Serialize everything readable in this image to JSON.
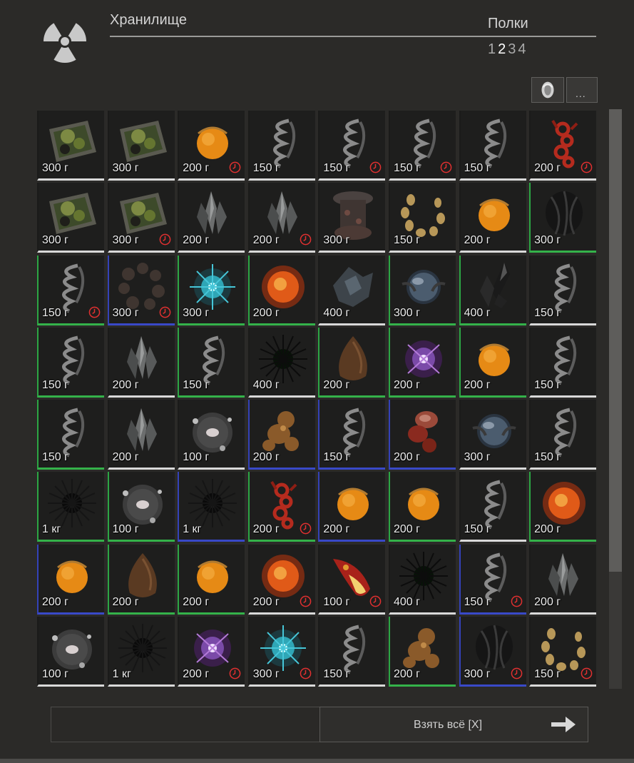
{
  "header": {
    "title": "Хранилище",
    "shelves_label": "Полки",
    "pages": [
      "1",
      "2",
      "3",
      "4"
    ],
    "active_page": "2",
    "logo_icon": "radiation-icon"
  },
  "toolbar": {
    "filter_icon": "artifact-filter-icon",
    "more_label": "..."
  },
  "colors": {
    "rarity_common": "#d9d9d9",
    "rarity_green": "#34b24a",
    "rarity_blue": "#3949c8",
    "timer_icon": "#e03030"
  },
  "grid": {
    "cells": [
      {
        "item": "moss",
        "weight": "300 г",
        "rarity": "common",
        "timer": false
      },
      {
        "item": "moss",
        "weight": "300 г",
        "rarity": "common",
        "timer": false
      },
      {
        "item": "orange-orb",
        "weight": "200 г",
        "rarity": "common",
        "timer": true
      },
      {
        "item": "shell",
        "weight": "150 г",
        "rarity": "common",
        "timer": false
      },
      {
        "item": "shell",
        "weight": "150 г",
        "rarity": "common",
        "timer": true
      },
      {
        "item": "shell",
        "weight": "150 г",
        "rarity": "common",
        "timer": true
      },
      {
        "item": "shell",
        "weight": "150 г",
        "rarity": "common",
        "timer": false
      },
      {
        "item": "red-chain",
        "weight": "200 г",
        "rarity": "common",
        "timer": true
      },
      {
        "item": "moss",
        "weight": "300 г",
        "rarity": "common",
        "timer": false
      },
      {
        "item": "moss",
        "weight": "300 г",
        "rarity": "common",
        "timer": true
      },
      {
        "item": "crystal",
        "weight": "200 г",
        "rarity": "common",
        "timer": false
      },
      {
        "item": "crystal",
        "weight": "200 г",
        "rarity": "common",
        "timer": true
      },
      {
        "item": "mushroom",
        "weight": "300 г",
        "rarity": "common",
        "timer": false
      },
      {
        "item": "bead-ring",
        "weight": "150 г",
        "rarity": "common",
        "timer": false
      },
      {
        "item": "orange-orb",
        "weight": "200 г",
        "rarity": "common",
        "timer": false
      },
      {
        "item": "black-cage",
        "weight": "300 г",
        "rarity": "green",
        "timer": false
      },
      {
        "item": "shell",
        "weight": "150 г",
        "rarity": "green",
        "timer": true
      },
      {
        "item": "dark-ring",
        "weight": "300 г",
        "rarity": "blue",
        "timer": true
      },
      {
        "item": "teal-burst",
        "weight": "300 г",
        "rarity": "green",
        "timer": false
      },
      {
        "item": "fire-orb",
        "weight": "200 г",
        "rarity": "green",
        "timer": false
      },
      {
        "item": "glass-shard",
        "weight": "400 г",
        "rarity": "common",
        "timer": false
      },
      {
        "item": "glass-sphere",
        "weight": "300 г",
        "rarity": "green",
        "timer": false
      },
      {
        "item": "black-crystal",
        "weight": "400 г",
        "rarity": "green",
        "timer": false
      },
      {
        "item": "shell",
        "weight": "150 г",
        "rarity": "common",
        "timer": false
      },
      {
        "item": "shell",
        "weight": "150 г",
        "rarity": "green",
        "timer": false
      },
      {
        "item": "crystal",
        "weight": "200 г",
        "rarity": "common",
        "timer": false
      },
      {
        "item": "shell",
        "weight": "150 г",
        "rarity": "green",
        "timer": false
      },
      {
        "item": "urchin-green",
        "weight": "400 г",
        "rarity": "common",
        "timer": false
      },
      {
        "item": "brown-stone",
        "weight": "200 г",
        "rarity": "green",
        "timer": false
      },
      {
        "item": "purple-orb",
        "weight": "200 г",
        "rarity": "green",
        "timer": false
      },
      {
        "item": "orange-orb",
        "weight": "200 г",
        "rarity": "green",
        "timer": false
      },
      {
        "item": "shell",
        "weight": "150 г",
        "rarity": "common",
        "timer": false
      },
      {
        "item": "shell",
        "weight": "150 г",
        "rarity": "green",
        "timer": false
      },
      {
        "item": "crystal",
        "weight": "200 г",
        "rarity": "common",
        "timer": false
      },
      {
        "item": "grey-blob",
        "weight": "100 г",
        "rarity": "common",
        "timer": false
      },
      {
        "item": "brown-lump",
        "weight": "200 г",
        "rarity": "blue",
        "timer": false
      },
      {
        "item": "shell",
        "weight": "150 г",
        "rarity": "blue",
        "timer": false
      },
      {
        "item": "red-lump",
        "weight": "200 г",
        "rarity": "blue",
        "timer": false
      },
      {
        "item": "glass-sphere",
        "weight": "300 г",
        "rarity": "common",
        "timer": false
      },
      {
        "item": "shell",
        "weight": "150 г",
        "rarity": "common",
        "timer": false
      },
      {
        "item": "urchin-black",
        "weight": "1 кг",
        "rarity": "green",
        "timer": false
      },
      {
        "item": "grey-blob",
        "weight": "100 г",
        "rarity": "green",
        "timer": false
      },
      {
        "item": "urchin-black",
        "weight": "1 кг",
        "rarity": "blue",
        "timer": false
      },
      {
        "item": "red-chain",
        "weight": "200 г",
        "rarity": "green",
        "timer": true
      },
      {
        "item": "orange-orb",
        "weight": "200 г",
        "rarity": "blue",
        "timer": false
      },
      {
        "item": "orange-orb",
        "weight": "200 г",
        "rarity": "green",
        "timer": false
      },
      {
        "item": "shell",
        "weight": "150 г",
        "rarity": "common",
        "timer": false
      },
      {
        "item": "fire-orb",
        "weight": "200 г",
        "rarity": "green",
        "timer": false
      },
      {
        "item": "orange-orb",
        "weight": "200 г",
        "rarity": "blue",
        "timer": false
      },
      {
        "item": "brown-stone",
        "weight": "200 г",
        "rarity": "green",
        "timer": false
      },
      {
        "item": "orange-orb",
        "weight": "200 г",
        "rarity": "green",
        "timer": false
      },
      {
        "item": "fire-orb",
        "weight": "200 г",
        "rarity": "common",
        "timer": true
      },
      {
        "item": "flame-shard",
        "weight": "100 г",
        "rarity": "common",
        "timer": true
      },
      {
        "item": "urchin-green",
        "weight": "400 г",
        "rarity": "common",
        "timer": false
      },
      {
        "item": "shell",
        "weight": "150 г",
        "rarity": "blue",
        "timer": true
      },
      {
        "item": "crystal",
        "weight": "200 г",
        "rarity": "common",
        "timer": false
      },
      {
        "item": "grey-blob",
        "weight": "100 г",
        "rarity": "common",
        "timer": false
      },
      {
        "item": "urchin-black",
        "weight": "1 кг",
        "rarity": "common",
        "timer": false
      },
      {
        "item": "purple-orb",
        "weight": "200 г",
        "rarity": "common",
        "timer": true
      },
      {
        "item": "teal-burst",
        "weight": "300 г",
        "rarity": "common",
        "timer": true
      },
      {
        "item": "shell",
        "weight": "150 г",
        "rarity": "common",
        "timer": false
      },
      {
        "item": "brown-lump",
        "weight": "200 г",
        "rarity": "green",
        "timer": false
      },
      {
        "item": "black-cage",
        "weight": "300 г",
        "rarity": "blue",
        "timer": true
      },
      {
        "item": "bead-ring",
        "weight": "150 г",
        "rarity": "common",
        "timer": true
      }
    ]
  },
  "actions": {
    "take_all_label": "Взять всё [X]",
    "take_all_icon": "arrow-right-icon"
  }
}
